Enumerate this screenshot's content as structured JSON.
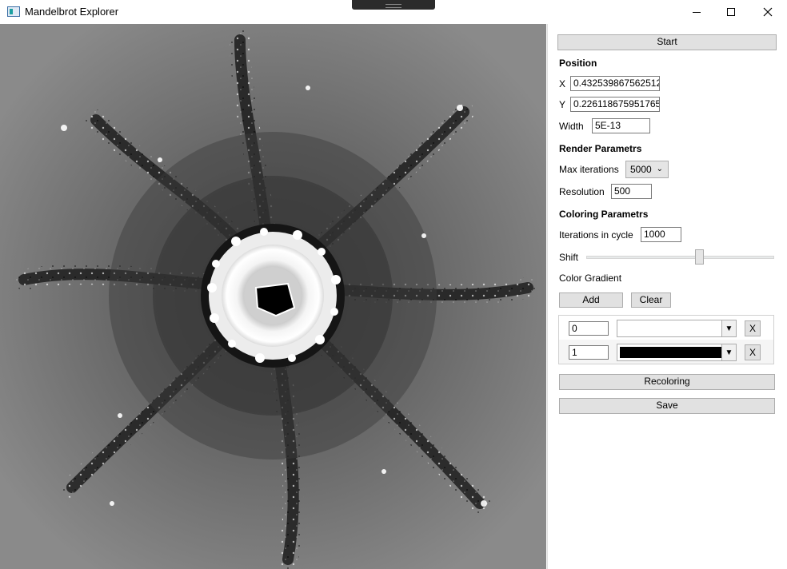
{
  "window": {
    "title": "Mandelbrot Explorer",
    "icon": "app-window-icon",
    "controls": {
      "minimize": "minimize-icon",
      "maximize": "maximize-icon",
      "close": "close-icon"
    }
  },
  "panel": {
    "start_label": "Start",
    "position": {
      "heading": "Position",
      "x_label": "X",
      "x_value": "0.432539867562512",
      "y_label": "Y",
      "y_value": "0.226118675951765",
      "width_label": "Width",
      "width_value": "5E-13"
    },
    "render": {
      "heading": "Render Parametrs",
      "max_iter_label": "Max iterations",
      "max_iter_value": "5000",
      "resolution_label": "Resolution",
      "resolution_value": "500"
    },
    "coloring": {
      "heading": "Coloring Parametrs",
      "iter_cycle_label": "Iterations in cycle",
      "iter_cycle_value": "1000",
      "shift_label": "Shift",
      "shift_fraction": 0.6,
      "gradient_label": "Color Gradient",
      "add_label": "Add",
      "clear_label": "Clear",
      "gradient_stops": [
        {
          "position": "0",
          "color": "#ffffff",
          "remove_label": "X"
        },
        {
          "position": "1",
          "color": "#000000",
          "remove_label": "X"
        }
      ]
    },
    "recolor_label": "Recoloring",
    "save_label": "Save"
  },
  "colors": {
    "accent": "#e1e1e1",
    "border": "#adadad",
    "fractal_bg": "#828282"
  }
}
